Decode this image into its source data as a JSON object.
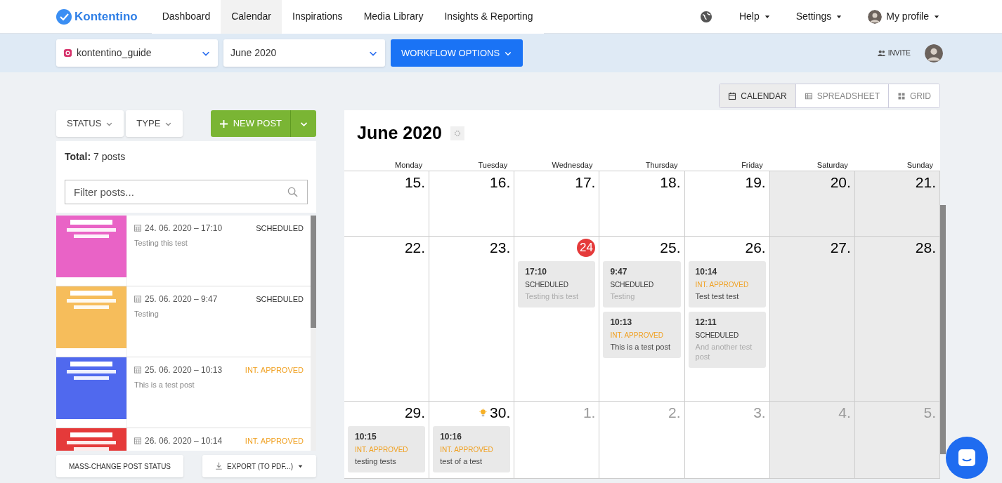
{
  "topbar": {
    "logo": "Kontentino",
    "nav": [
      {
        "label": "Dashboard",
        "selected": false
      },
      {
        "label": "Calendar",
        "selected": true
      },
      {
        "label": "Inspirations",
        "selected": false
      },
      {
        "label": "Media Library",
        "selected": false
      },
      {
        "label": "Insights & Reporting",
        "selected": false
      }
    ],
    "right_menus": [
      "Help",
      "Settings",
      "My profile"
    ]
  },
  "subbar": {
    "account": "kontentino_guide",
    "month": "June 2020",
    "workflow_button": "WORKFLOW OPTIONS",
    "invite": "INVITE"
  },
  "view_switch": [
    {
      "label": "CALENDAR",
      "kind": "calendar",
      "selected": true
    },
    {
      "label": "SPREADSHEET",
      "kind": "spreadsheet",
      "selected": false
    },
    {
      "label": "GRID",
      "kind": "grid",
      "selected": false
    }
  ],
  "sidebar": {
    "filters": [
      "STATUS",
      "TYPE"
    ],
    "new_post": "NEW POST",
    "total_label": "Total:",
    "total_value": "7 posts",
    "search": {
      "placeholder": "Filter posts..."
    },
    "posts": [
      {
        "color": "#e963c6",
        "date": "24. 06. 2020 – 17:10",
        "status": "SCHEDULED",
        "kind": "scheduled",
        "text": "Testing this test"
      },
      {
        "color": "#f6bd5b",
        "date": "25. 06. 2020 – 9:47",
        "status": "SCHEDULED",
        "kind": "scheduled",
        "text": "Testing"
      },
      {
        "color": "#5069ee",
        "date": "25. 06. 2020 – 10:13",
        "status": "INT. APPROVED",
        "kind": "approved",
        "text": "This is a test post"
      },
      {
        "color": "#e53a3a",
        "date": "26. 06. 2020 – 10:14",
        "status": "INT. APPROVED",
        "kind": "approved"
      }
    ],
    "mass_change": "MASS-CHANGE POST STATUS",
    "export": "EXPORT (TO PDF...)"
  },
  "calendar": {
    "title": "June 2020",
    "weekdays": [
      "Monday",
      "Tuesday",
      "Wednesday",
      "Thursday",
      "Friday",
      "Saturday",
      "Sunday"
    ],
    "weeks": [
      [
        {
          "day": "15.",
          "muted": false,
          "weekend": false
        },
        {
          "day": "16.",
          "muted": false,
          "weekend": false
        },
        {
          "day": "17.",
          "muted": false,
          "weekend": false
        },
        {
          "day": "18.",
          "muted": false,
          "weekend": false
        },
        {
          "day": "19.",
          "muted": false,
          "weekend": false
        },
        {
          "day": "20.",
          "muted": false,
          "weekend": true
        },
        {
          "day": "21.",
          "muted": false,
          "weekend": true
        }
      ],
      [
        {
          "day": "22.",
          "muted": false,
          "weekend": false
        },
        {
          "day": "23.",
          "muted": false,
          "weekend": false
        },
        {
          "day": "24",
          "muted": false,
          "weekend": false,
          "today": true,
          "posts": [
            {
              "time": "17:10",
              "status": "SCHEDULED",
              "kind": "scheduled",
              "text": "Testing this test",
              "dimmed": true
            }
          ]
        },
        {
          "day": "25.",
          "muted": false,
          "weekend": false,
          "posts": [
            {
              "time": "9:47",
              "status": "SCHEDULED",
              "kind": "scheduled",
              "text": "Testing",
              "dimmed": true
            },
            {
              "time": "10:13",
              "status": "INT. APPROVED",
              "kind": "approved",
              "text": "This is a test post",
              "dimmed": false
            }
          ]
        },
        {
          "day": "26.",
          "muted": false,
          "weekend": false,
          "posts": [
            {
              "time": "10:14",
              "status": "INT. APPROVED",
              "kind": "approved",
              "text": "Test test test",
              "dimmed": false
            },
            {
              "time": "12:11",
              "status": "SCHEDULED",
              "kind": "scheduled",
              "text": "And another test post",
              "dimmed": true
            }
          ]
        },
        {
          "day": "27.",
          "muted": false,
          "weekend": true
        },
        {
          "day": "28.",
          "muted": false,
          "weekend": true
        }
      ],
      [
        {
          "day": "29.",
          "muted": false,
          "weekend": false,
          "posts": [
            {
              "time": "10:15",
              "status": "INT. APPROVED",
              "kind": "approved",
              "text": "testing tests",
              "dimmed": false
            }
          ]
        },
        {
          "day": "30.",
          "muted": false,
          "weekend": false,
          "idea": true,
          "posts": [
            {
              "time": "10:16",
              "status": "INT. APPROVED",
              "kind": "approved",
              "text": "test of a test",
              "dimmed": false
            }
          ]
        },
        {
          "day": "1.",
          "muted": true,
          "weekend": false
        },
        {
          "day": "2.",
          "muted": true,
          "weekend": false
        },
        {
          "day": "3.",
          "muted": true,
          "weekend": false
        },
        {
          "day": "4.",
          "muted": true,
          "weekend": true
        },
        {
          "day": "5.",
          "muted": true,
          "weekend": true
        }
      ]
    ]
  }
}
